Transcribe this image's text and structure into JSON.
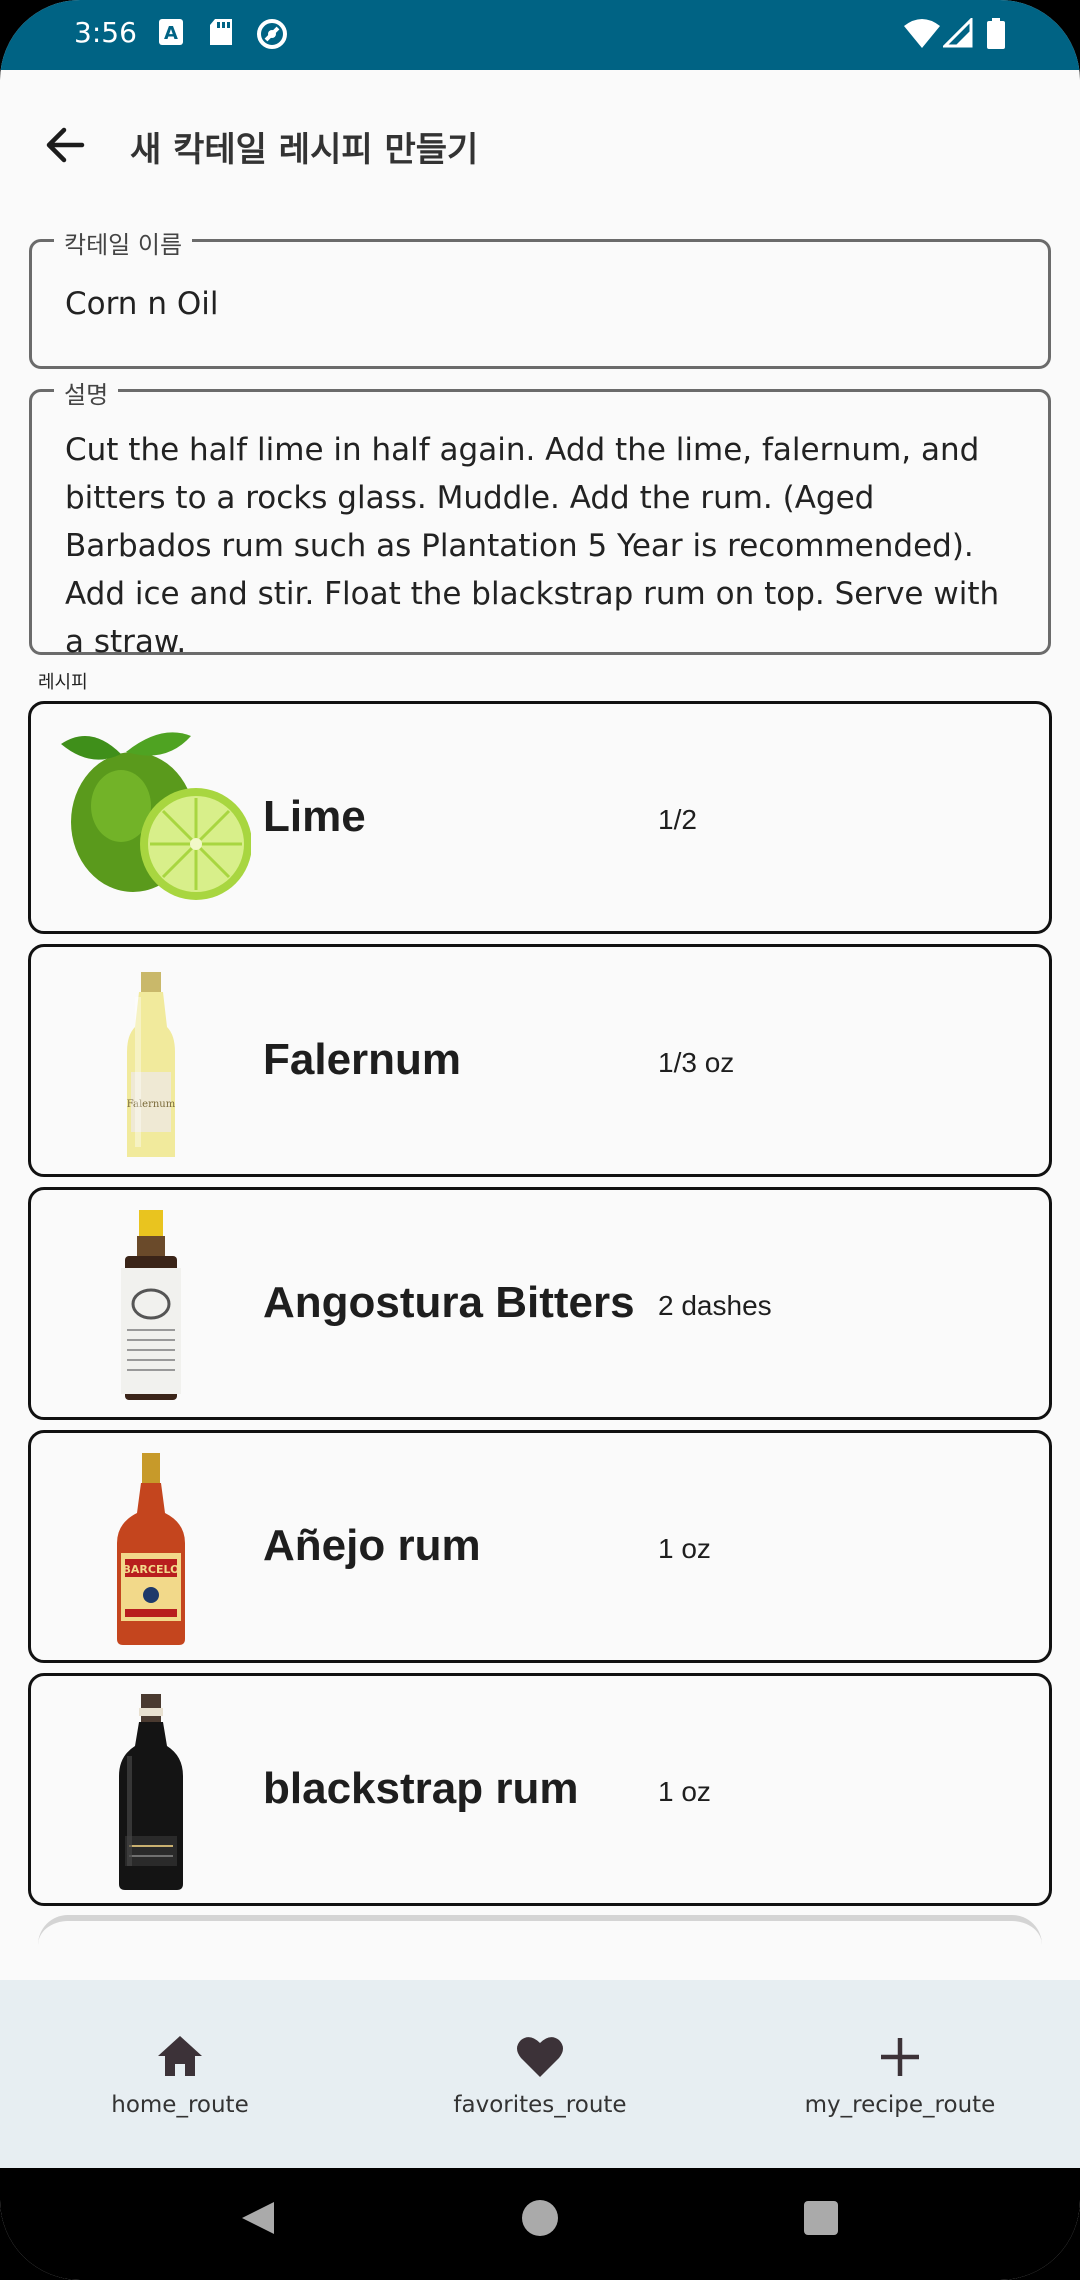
{
  "status_bar": {
    "time": "3:56",
    "left_icons": [
      "a-icon",
      "sd-card-icon",
      "sync-icon"
    ],
    "right_icons": [
      "wifi-icon",
      "signal-icon",
      "battery-icon"
    ],
    "color": "#006384"
  },
  "app_bar": {
    "title": "새 칵테일 레시피 만들기",
    "back_icon": "arrow-back-icon"
  },
  "form": {
    "name_label": "칵테일 이름",
    "name_value": "Corn n Oil",
    "description_label": "설명",
    "description_value": "Cut the half lime in half again. Add the lime, falernum, and bitters to a rocks glass. Muddle. Add the rum. (Aged Barbados rum such as Plantation 5 Year is recommended). Add ice and stir. Float the blackstrap rum on top. Serve with a straw.",
    "recipe_label": "레시피"
  },
  "ingredients": [
    {
      "name": "Lime",
      "quantity": "1/2",
      "image": "lime-image"
    },
    {
      "name": "Falernum",
      "quantity": "1/3 oz",
      "image": "falernum-bottle-image"
    },
    {
      "name": "Angostura Bitters",
      "quantity": "2 dashes",
      "image": "angostura-bottle-image"
    },
    {
      "name": "Añejo rum",
      "quantity": "1 oz",
      "image": "anejo-rum-bottle-image"
    },
    {
      "name": "blackstrap rum",
      "quantity": "1 oz",
      "image": "blackstrap-rum-bottle-image"
    }
  ],
  "bottom_nav": {
    "items": [
      {
        "label": "home_route",
        "icon": "home-icon"
      },
      {
        "label": "favorites_route",
        "icon": "heart-icon"
      },
      {
        "label": "my_recipe_route",
        "icon": "plus-icon"
      }
    ]
  },
  "system_nav": [
    "back-triangle-icon",
    "home-circle-icon",
    "recents-square-icon"
  ]
}
